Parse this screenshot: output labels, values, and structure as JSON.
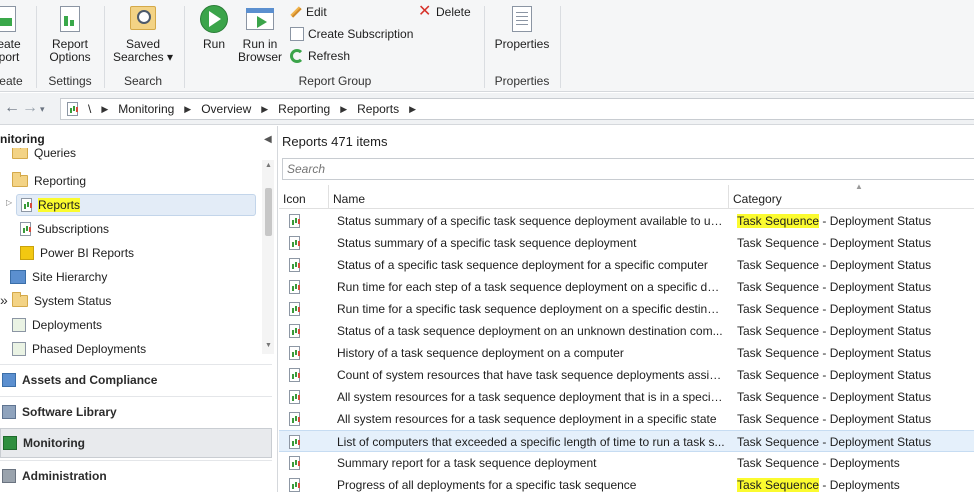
{
  "ribbon": {
    "create_report": "eate\nport",
    "create_group": "reate",
    "report_options": "Report\nOptions",
    "settings_group": "Settings",
    "saved_searches": "Saved\nSearches ▾",
    "search_group": "Search",
    "run": "Run",
    "run_in_browser": "Run in\nBrowser",
    "edit": "Edit",
    "delete": "Delete",
    "create_subscription": "Create Subscription",
    "refresh": "Refresh",
    "report_group": "Report Group",
    "properties": "Properties",
    "properties_group": "Properties"
  },
  "breadcrumb": {
    "root": "\\",
    "items": [
      "Monitoring",
      "Overview",
      "Reporting",
      "Reports"
    ]
  },
  "left_pane": {
    "title": "nitoring",
    "tree": [
      {
        "label": "Queries"
      },
      {
        "label": "Reporting"
      },
      {
        "label": "Reports"
      },
      {
        "label": "Subscriptions"
      },
      {
        "label": "Power BI Reports"
      },
      {
        "label": "Site Hierarchy"
      },
      {
        "label": "System Status"
      },
      {
        "label": "Deployments"
      },
      {
        "label": "Phased Deployments"
      }
    ],
    "workspaces": [
      {
        "label": "Assets and Compliance"
      },
      {
        "label": "Software Library"
      },
      {
        "label": "Monitoring"
      },
      {
        "label": "Administration"
      }
    ]
  },
  "right_pane": {
    "title": "Reports 471 items",
    "search_placeholder": "Search",
    "columns": {
      "icon": "Icon",
      "name": "Name",
      "category": "Category"
    },
    "rows": [
      {
        "name": "Status summary of a specific task sequence deployment available to un...",
        "cat_a": "Task Sequence",
        "cat_b": " - Deployment Status"
      },
      {
        "name": "Status summary of a specific task sequence deployment",
        "cat_a": "Task Sequence",
        "cat_b": " - Deployment Status"
      },
      {
        "name": "Status of a specific task sequence deployment for a specific computer",
        "cat_a": "Task Sequence",
        "cat_b": " - Deployment Status"
      },
      {
        "name": "Run time for each step of a task sequence deployment on a specific des...",
        "cat_a": "Task Sequence",
        "cat_b": " - Deployment Status"
      },
      {
        "name": "Run time for a specific task sequence deployment on a specific destinat...",
        "cat_a": "Task Sequence",
        "cat_b": " - Deployment Status"
      },
      {
        "name": "Status of a task sequence deployment on an unknown destination com...",
        "cat_a": "Task Sequence",
        "cat_b": " - Deployment Status"
      },
      {
        "name": "History of a task sequence deployment on a computer",
        "cat_a": "Task Sequence",
        "cat_b": " - Deployment Status"
      },
      {
        "name": "Count of system resources that have task sequence deployments assign...",
        "cat_a": "Task Sequence",
        "cat_b": " - Deployment Status"
      },
      {
        "name": "All system resources for a task sequence deployment that is in a specifi...",
        "cat_a": "Task Sequence",
        "cat_b": " - Deployment Status"
      },
      {
        "name": "All system resources for a task sequence deployment in a specific state",
        "cat_a": "Task Sequence",
        "cat_b": " - Deployment Status"
      },
      {
        "name": "List of computers that exceeded a specific length of time to run a task s...",
        "cat_a": "Task Sequence",
        "cat_b": " - Deployment Status"
      },
      {
        "name": "Summary report for a task sequence deployment",
        "cat_a": "Task Sequence",
        "cat_b": " - Deployments"
      },
      {
        "name": "Progress of all deployments for a specific task sequence",
        "cat_a": "Task Sequence",
        "cat_b": " - Deployments"
      }
    ]
  }
}
